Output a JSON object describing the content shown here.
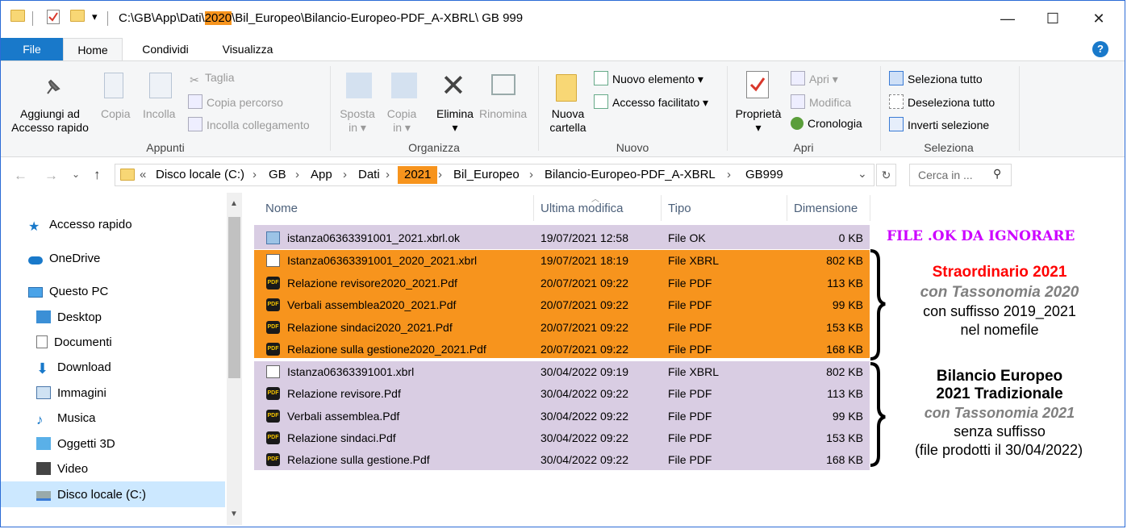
{
  "title": {
    "prefix": "C:\\GB\\App\\Dati\\",
    "highlight": "2020",
    "suffix": "\\Bil_Europeo\\Bilancio-Europeo-PDF_A-XBRL\\ GB 999"
  },
  "window_controls": {
    "minimize": "—",
    "maximize": "☐",
    "close": "✕"
  },
  "tabs": [
    "File",
    "Home",
    "Condividi",
    "Visualizza"
  ],
  "ribbon": {
    "pin": "Aggiungi ad Accesso rapido",
    "pin_line1": "Aggiungi ad",
    "pin_line2": "Accesso rapido",
    "copy": "Copia",
    "paste": "Incolla",
    "cut": "Taglia",
    "copy_path": "Copia percorso",
    "paste_link": "Incolla collegamento",
    "move_line1": "Sposta",
    "move_line2": "in",
    "copyto_line1": "Copia",
    "copyto_line2": "in",
    "delete": "Elimina",
    "rename": "Rinomina",
    "newfolder_line1": "Nuova",
    "newfolder_line2": "cartella",
    "new_item": "Nuovo elemento",
    "easy_access": "Accesso facilitato",
    "properties": "Proprietà",
    "open": "Apri",
    "edit": "Modifica",
    "history": "Cronologia",
    "select_all": "Seleziona tutto",
    "select_none": "Deseleziona tutto",
    "invert": "Inverti selezione",
    "groups": {
      "clipboard": "Appunti",
      "organize": "Organizza",
      "new": "Nuovo",
      "open": "Apri",
      "select": "Seleziona"
    }
  },
  "address": {
    "crumbs": [
      "Disco locale (C:)",
      "GB",
      "App",
      "Dati",
      "2021",
      "Bil_Europeo",
      "Bilancio-Europeo-PDF_A-XBRL",
      "GB999"
    ],
    "search_placeholder": "Cerca in ..."
  },
  "nav": [
    "Accesso rapido",
    "OneDrive",
    "Questo PC",
    "Desktop",
    "Documenti",
    "Download",
    "Immagini",
    "Musica",
    "Oggetti 3D",
    "Video",
    "Disco locale (C:)"
  ],
  "columns": {
    "name": "Nome",
    "modified": "Ultima modifica",
    "type": "Tipo",
    "size": "Dimensione"
  },
  "files": [
    {
      "name": "istanza06363391001_2021.xbrl.ok",
      "date": "19/07/2021 12:58",
      "type": "File OK",
      "size": "0 KB",
      "icon": "ok-file-icon"
    },
    {
      "name": "Istanza06363391001_2020_2021.xbrl",
      "date": "19/07/2021 18:19",
      "type": "File XBRL",
      "size": "802 KB",
      "icon": "xbrl-file-icon"
    },
    {
      "name": "Relazione revisore2020_2021.Pdf",
      "date": "20/07/2021 09:22",
      "type": "File PDF",
      "size": "113 KB",
      "icon": "pdf-file-icon"
    },
    {
      "name": "Verbali assemblea2020_2021.Pdf",
      "date": "20/07/2021 09:22",
      "type": "File PDF",
      "size": "99 KB",
      "icon": "pdf-file-icon"
    },
    {
      "name": "Relazione sindaci2020_2021.Pdf",
      "date": "20/07/2021 09:22",
      "type": "File PDF",
      "size": "153 KB",
      "icon": "pdf-file-icon"
    },
    {
      "name": "Relazione sulla gestione2020_2021.Pdf",
      "date": "20/07/2021 09:22",
      "type": "File PDF",
      "size": "168 KB",
      "icon": "pdf-file-icon"
    },
    {
      "name": "Istanza06363391001.xbrl",
      "date": "30/04/2022 09:19",
      "type": "File XBRL",
      "size": "802 KB",
      "icon": "xbrl-file-icon"
    },
    {
      "name": "Relazione revisore.Pdf",
      "date": "30/04/2022 09:22",
      "type": "File PDF",
      "size": "113 KB",
      "icon": "pdf-file-icon"
    },
    {
      "name": "Verbali assemblea.Pdf",
      "date": "30/04/2022 09:22",
      "type": "File PDF",
      "size": "99 KB",
      "icon": "pdf-file-icon"
    },
    {
      "name": "Relazione sindaci.Pdf",
      "date": "30/04/2022 09:22",
      "type": "File PDF",
      "size": "153 KB",
      "icon": "pdf-file-icon"
    },
    {
      "name": "Relazione sulla gestione.Pdf",
      "date": "30/04/2022 09:22",
      "type": "File PDF",
      "size": "168 KB",
      "icon": "pdf-file-icon"
    }
  ],
  "annotations": {
    "ok_note": "FILE .OK DA IGNORARE",
    "group1": {
      "line1": "Straordinario  2021",
      "line2": "con Tassonomia 2020",
      "line3": "con suffisso 2019_2021",
      "line4": "nel nomefile"
    },
    "group2": {
      "line1": "Bilancio Europeo",
      "line2": "2021 Tradizionale",
      "line3": "con Tassonomia 2021",
      "line4": "senza suffisso",
      "line5": "(file prodotti il 30/04/2022)"
    }
  },
  "colors": {
    "orange": "#f7941d",
    "lavender": "#d9cde3",
    "accent": "#1979ca",
    "red": "#ff0000",
    "purple": "#cc00ff"
  }
}
